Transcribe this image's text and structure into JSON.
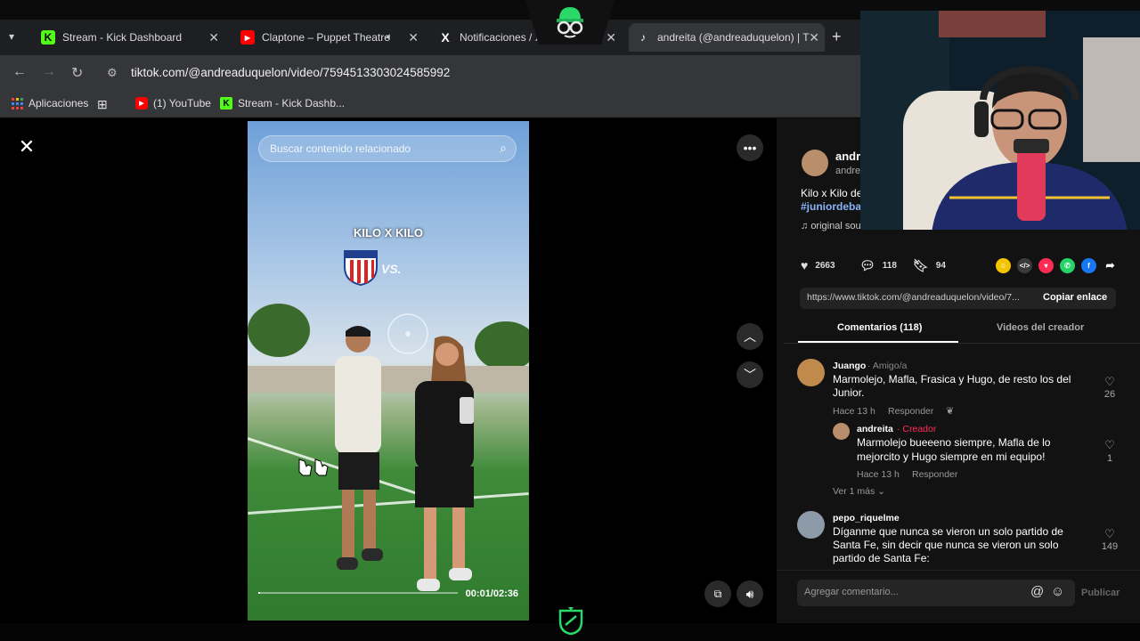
{
  "browser": {
    "tabs": [
      {
        "label": "Stream - Kick Dashboard",
        "icon": "kick-icon"
      },
      {
        "label": "Claptone – Puppet Theatre",
        "icon": "youtube-icon"
      },
      {
        "label": "Notificaciones / X",
        "icon": "x-icon"
      },
      {
        "label": "andreita (@andreaduquelon) | T",
        "icon": "tiktok-icon"
      }
    ],
    "url": "tiktok.com/@andreaduquelon/video/7594513303024585992",
    "bookmarks": [
      {
        "label": "Aplicaciones",
        "icon": "apps-icon"
      },
      {
        "label": "(1) YouTube",
        "icon": "youtube-icon"
      },
      {
        "label": "Stream - Kick Dashb...",
        "icon": "kick-icon"
      }
    ]
  },
  "video": {
    "search_placeholder": "Buscar contenido relacionado",
    "title_overlay": "KILO X KILO",
    "vs_text": "VS.",
    "time": "00:01/02:36",
    "progress": 0.01
  },
  "author": {
    "name": "andr",
    "handle": "andre",
    "description": "Kilo x Kilo de",
    "hashtag": "#juniordeba",
    "sound": "original sound - andreita"
  },
  "stats": {
    "likes": "2663",
    "comments": "118",
    "saves": "94"
  },
  "share": {
    "link": "https://www.tiktok.com/@andreaduquelon/video/7...",
    "copy_label": "Copiar enlace"
  },
  "comment_tabs": {
    "comments": "Comentarios (118)",
    "creator_videos": "Videos del creador"
  },
  "comments": [
    {
      "user": "Juango",
      "tag": "· Amigo/a",
      "text_line1": "Marmolejo, Mafla, Frasica y Hugo, de resto los del",
      "text_line2": "Junior.",
      "time": "Hace 13 h",
      "reply": "Responder",
      "likes": "26"
    },
    {
      "user": "andreita",
      "tag": "· Creador",
      "text_line1": "Marmolejo bueeeno siempre, Mafla de lo",
      "text_line2": "mejorcito y Hugo siempre en mi equipo!",
      "time": "Hace 13 h",
      "reply": "Responder",
      "likes": "1"
    },
    {
      "user": "pepo_riquelme",
      "tag": "",
      "text_line1": "Díganme que nunca se vieron un solo partido de",
      "text_line2": "Santa Fe, sin decir que nunca se vieron un solo",
      "text_line3": "partido de Santa Fe:",
      "likes": "149"
    }
  ],
  "view_more": "Ver 1 más",
  "comment_input": {
    "placeholder": "Agregar comentario...",
    "publish": "Publicar"
  },
  "colors": {
    "kick_green": "#53fc18",
    "youtube_red": "#ff0000",
    "creator_red": "#fe2c55",
    "link_blue": "#8ab4f8"
  }
}
